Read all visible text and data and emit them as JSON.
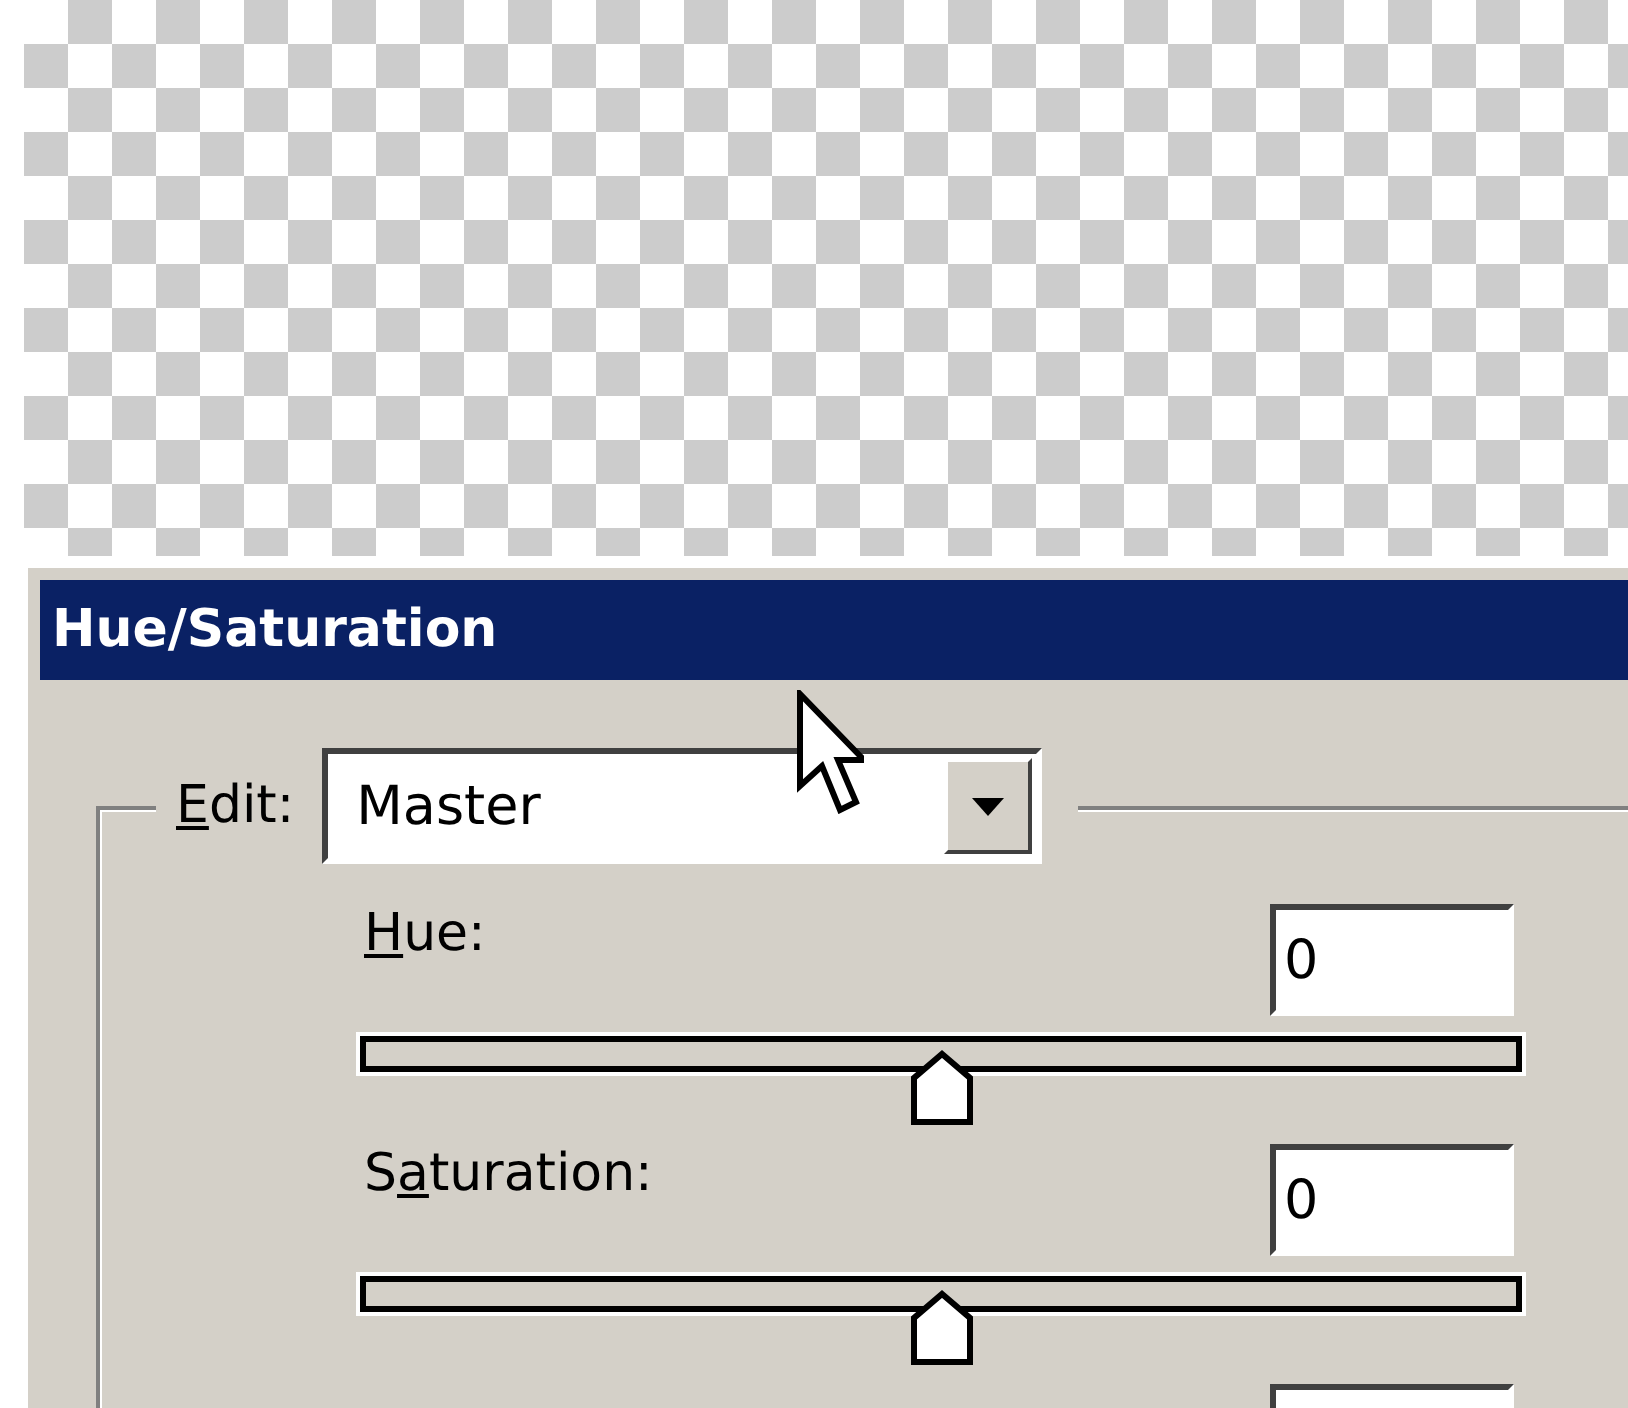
{
  "window": {
    "title": "Hue/Saturation"
  },
  "edit": {
    "access_key": "E",
    "label_end": "dit:",
    "value": "Master"
  },
  "sliders": [
    {
      "kind": "slider",
      "access_key": "H",
      "label_end": "ue:",
      "value": "0",
      "level": 0.5
    },
    {
      "kind": "slider",
      "label_start": "S",
      "access_key": "a",
      "label_end": "turation:",
      "value": "0",
      "level": 0.5
    },
    {
      "kind": "field_only"
    }
  ]
}
